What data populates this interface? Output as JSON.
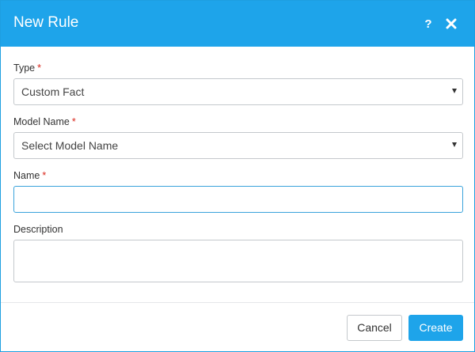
{
  "dialog": {
    "title": "New Rule",
    "help_icon": "question-mark-icon",
    "close_icon": "close-x-icon"
  },
  "form": {
    "type": {
      "label": "Type",
      "required": "*",
      "value": "Custom Fact"
    },
    "model_name": {
      "label": "Model Name",
      "required": "*",
      "value": "Select Model Name"
    },
    "name": {
      "label": "Name",
      "required": "*",
      "value": ""
    },
    "description": {
      "label": "Description",
      "value": ""
    }
  },
  "footer": {
    "cancel_label": "Cancel",
    "create_label": "Create"
  },
  "colors": {
    "accent": "#1ea4ea",
    "required": "#d9271c",
    "border": "#c4c8cc",
    "focus_border": "#3aa3db"
  }
}
